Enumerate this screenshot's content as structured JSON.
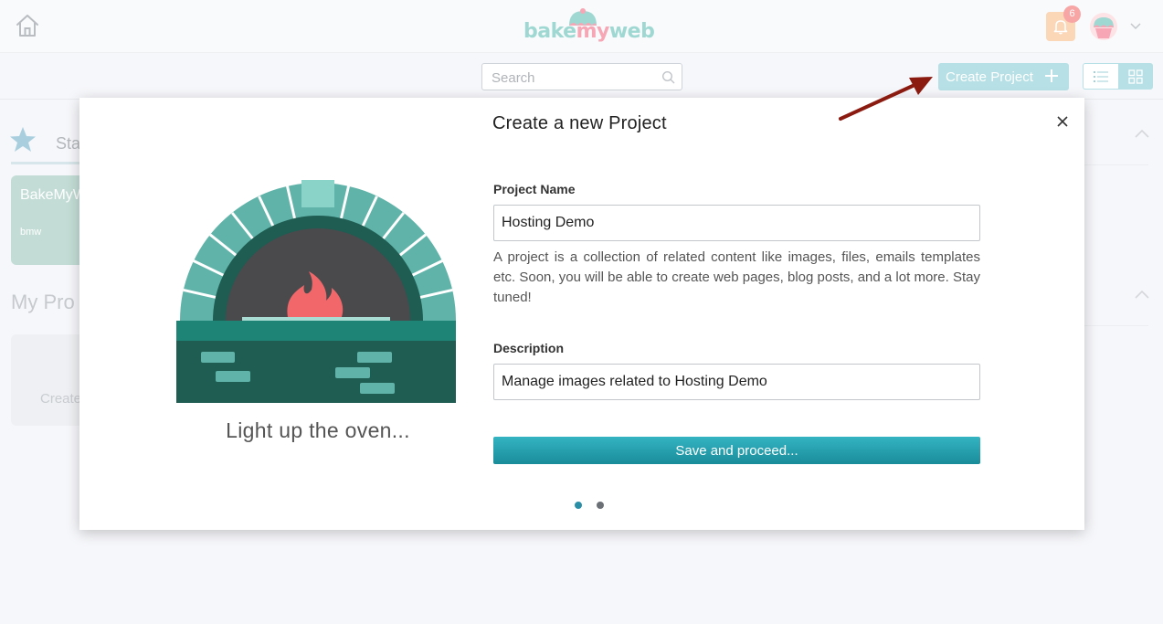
{
  "header": {
    "logo": {
      "part1": "bake",
      "part2": "my",
      "part3": "web"
    },
    "notifications": {
      "count": "6"
    }
  },
  "toolbar": {
    "search_placeholder": "Search",
    "create_project_label": "Create Project"
  },
  "background": {
    "starred_tab_partial": "Sta",
    "card_title_partial": "BakeMyW",
    "card_subtitle": "bmw",
    "my_projects_partial": "My Pro",
    "create_card_partial": "Create"
  },
  "modal": {
    "title": "Create a new Project",
    "illustration_caption": "Light up the oven...",
    "project_name_label": "Project Name",
    "project_name_value": "Hosting Demo",
    "help_text": "A project is a collection of related content like images, files, emails templates etc. Soon, you will be able to create web pages, blog posts, and a lot more. Stay tuned!",
    "description_label": "Description",
    "description_value": "Manage images related to Hosting Demo",
    "save_label": "Save and proceed...",
    "steps": {
      "current": 1,
      "total": 2
    }
  },
  "colors": {
    "accent": "#2aa7b6",
    "accent_light": "#b6e0e5",
    "arrow": "#8b1a10",
    "oven_dark": "#1f5c52",
    "oven_brick": "#5fb3a8",
    "flame": "#f2686a"
  }
}
